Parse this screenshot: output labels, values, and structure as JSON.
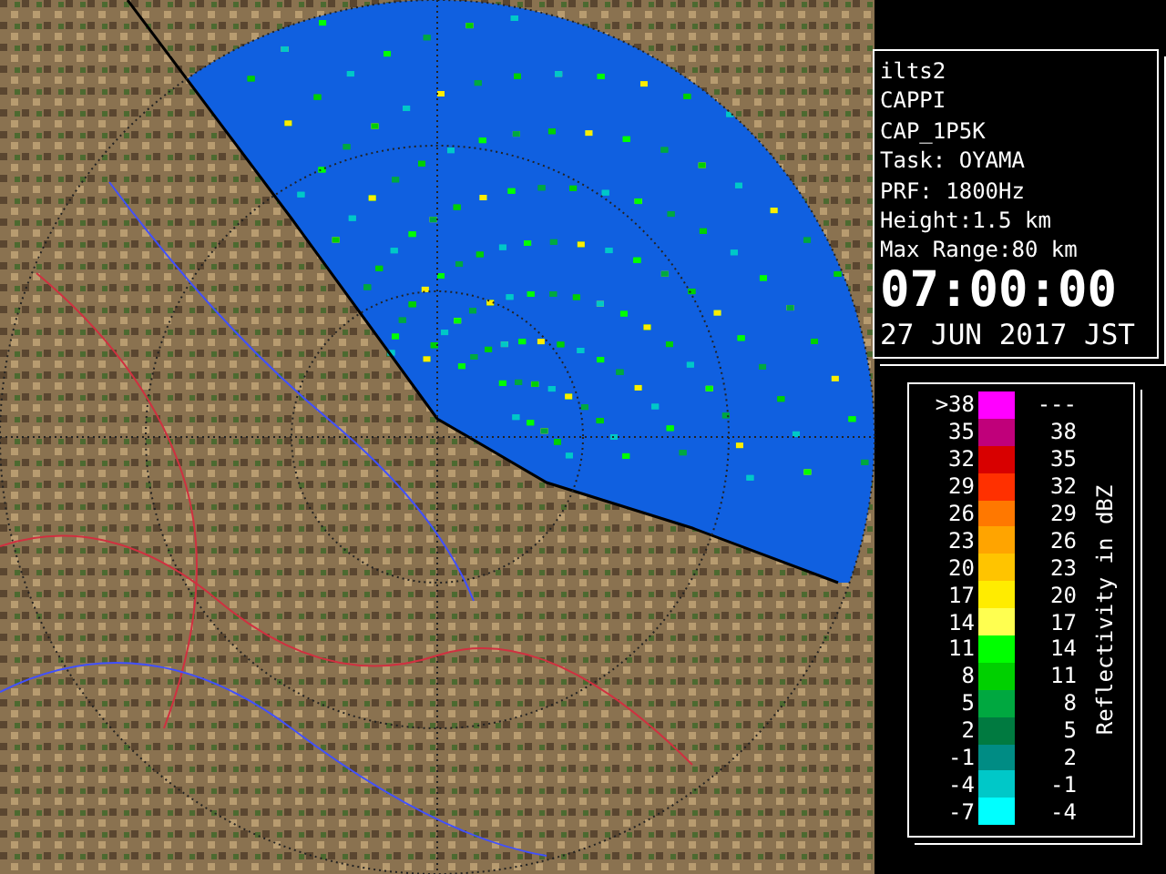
{
  "info": {
    "lines": [
      "ilts2",
      "CAPPI",
      "CAP_1P5K",
      "Task: OYAMA",
      "PRF: 1800Hz",
      "Height:1.5 km",
      "Max Range:80 km"
    ],
    "time": "07:00:00",
    "date": "27 JUN 2017 JST"
  },
  "legend": {
    "title": "Reflectivity in dBZ",
    "rows": [
      {
        "low": ">38",
        "high": "---",
        "color": "#ff00ff"
      },
      {
        "low": "35",
        "high": "38",
        "color": "#c0007a"
      },
      {
        "low": "32",
        "high": "35",
        "color": "#d80000"
      },
      {
        "low": "29",
        "high": "32",
        "color": "#ff3000"
      },
      {
        "low": "26",
        "high": "29",
        "color": "#ff7800"
      },
      {
        "low": "23",
        "high": "26",
        "color": "#ffa400"
      },
      {
        "low": "20",
        "high": "23",
        "color": "#ffc400"
      },
      {
        "low": "17",
        "high": "20",
        "color": "#ffec00"
      },
      {
        "low": "14",
        "high": "17",
        "color": "#ffff50"
      },
      {
        "low": "11",
        "high": "14",
        "color": "#00ff00"
      },
      {
        "low": "8",
        "high": "11",
        "color": "#00d000"
      },
      {
        "low": "5",
        "high": "8",
        "color": "#00a840"
      },
      {
        "low": "2",
        "high": "5",
        "color": "#007a40"
      },
      {
        "low": "-1",
        "high": "2",
        "color": "#008c84"
      },
      {
        "low": "-4",
        "high": "-1",
        "color": "#00c8c8"
      },
      {
        "low": "-7",
        "high": "-4",
        "color": "#00ffff"
      }
    ]
  }
}
